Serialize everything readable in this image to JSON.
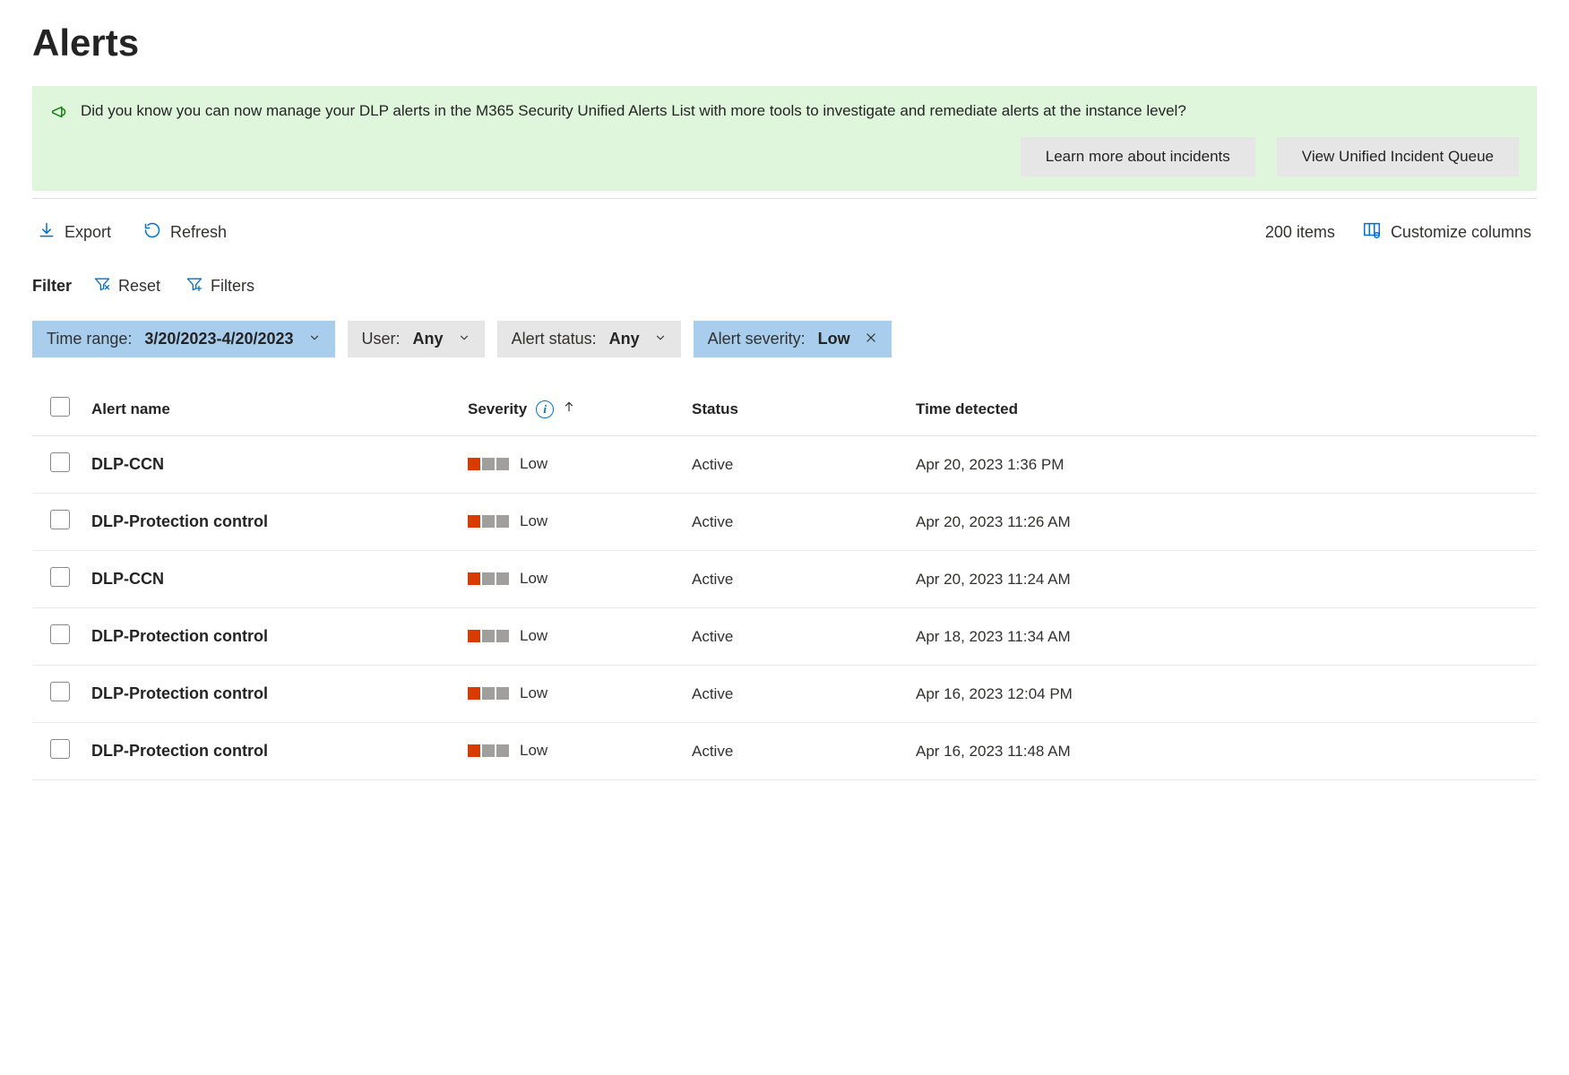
{
  "page": {
    "title": "Alerts"
  },
  "banner": {
    "text": "Did you know you can now manage your DLP alerts in the M365 Security Unified Alerts List with more tools to investigate and remediate alerts at the instance level?",
    "learn_more": "Learn more about incidents",
    "view_queue": "View Unified Incident Queue"
  },
  "toolbar": {
    "export": "Export",
    "refresh": "Refresh",
    "item_count": "200 items",
    "customize": "Customize columns"
  },
  "filter_bar": {
    "label": "Filter",
    "reset": "Reset",
    "filters": "Filters"
  },
  "pills": {
    "time_range": {
      "key": "Time range:",
      "value": "3/20/2023-4/20/2023"
    },
    "user": {
      "key": "User:",
      "value": "Any"
    },
    "status": {
      "key": "Alert status:",
      "value": "Any"
    },
    "severity": {
      "key": "Alert severity:",
      "value": "Low"
    }
  },
  "columns": {
    "name": "Alert name",
    "severity": "Severity",
    "status": "Status",
    "time": "Time detected"
  },
  "rows": [
    {
      "name": "DLP-CCN",
      "severity": "Low",
      "status": "Active",
      "time": "Apr 20, 2023 1:36 PM"
    },
    {
      "name": "DLP-Protection control",
      "severity": "Low",
      "status": "Active",
      "time": "Apr 20, 2023 11:26 AM"
    },
    {
      "name": "DLP-CCN",
      "severity": "Low",
      "status": "Active",
      "time": "Apr 20, 2023 11:24 AM"
    },
    {
      "name": "DLP-Protection control",
      "severity": "Low",
      "status": "Active",
      "time": "Apr 18, 2023 11:34 AM"
    },
    {
      "name": "DLP-Protection control",
      "severity": "Low",
      "status": "Active",
      "time": "Apr 16, 2023 12:04 PM"
    },
    {
      "name": "DLP-Protection control",
      "severity": "Low",
      "status": "Active",
      "time": "Apr 16, 2023 11:48 AM"
    }
  ]
}
